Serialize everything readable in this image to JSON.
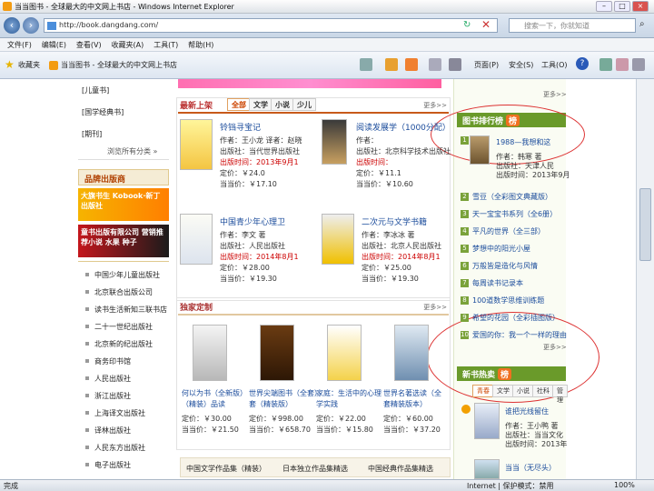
{
  "window": {
    "title": "当当图书 - 全球最大的中文网上书店 - Windows Internet Explorer",
    "min": "–",
    "max": "□",
    "close": "×"
  },
  "address": {
    "url": "http://book.dangdang.com/",
    "search_placeholder": "搜索一下，你就知道"
  },
  "menu": [
    "文件(F)",
    "编辑(E)",
    "查看(V)",
    "收藏夹(A)",
    "工具(T)",
    "帮助(H)"
  ],
  "favbar": {
    "favorites": "收藏夹",
    "tab": "当当图书 - 全球最大的中文网上书店",
    "page": "页面(P)",
    "safety": "安全(S)",
    "tools": "工具(O)"
  },
  "left": {
    "links_top": [
      "[儿童书]",
      "[国学经典书]",
      "[期刊]"
    ],
    "more_categories": "浏览所有分类 »",
    "promo_title": "品牌出版商",
    "banner1": "大旗书生 Kobook·新丁 出版社",
    "banner2": "童书出版有限公司 营销推荐小说 水果 种子",
    "publishers": [
      "中国少年儿童出版社",
      "北京联合出版公司",
      "读书生活新知三联书店",
      "二十一世纪出版社",
      "北京新的纪出版社",
      "商务印书馆",
      "人民出版社",
      "浙江出版社",
      "上海译文出版社",
      "译林出版社",
      "人民东方出版社",
      "电子出版社"
    ]
  },
  "center": {
    "new": {
      "title": "最新上架",
      "tabs": [
        "全部",
        "文学",
        "小说",
        "少儿"
      ],
      "more": "更多>>",
      "books": [
        {
          "title": "铃铛寻宝记",
          "l1": "作者：王小龙  译者：赵晓",
          "l2": "出版社：当代世界出版社",
          "l3": "出版时间：2013年9月1",
          "l4": "定价：￥24.0",
          "l5": "当当价：￥17.10"
        },
        {
          "title": "阅读发展学（1000分配）",
          "l1": "作者：",
          "l2": "出版社：北京科学技术出版社",
          "l3": "出版时间：",
          "l4": "定价：￥11.1",
          "l5": "当当价：￥10.60"
        },
        {
          "title": "中国青少年心理卫",
          "l1": "作者：李文 著",
          "l2": "出版社：人民出版社",
          "l3": "出版时间：2014年8月1",
          "l4": "定价：￥28.00",
          "l5": "当当价：￥19.30"
        },
        {
          "title": "二次元与文学书籍",
          "l1": "作者：李冰冰 著",
          "l2": "出版社：北京人民出版社",
          "l3": "出版时间：2014年8月1",
          "l4": "定价：￥25.00",
          "l5": "当当价：￥19.30"
        }
      ]
    },
    "excl": {
      "title": "独家定制",
      "more": "更多>>",
      "books": [
        {
          "title": "何以为书（全新版）",
          "sub": "（精装）品读",
          "p1": "定价：￥30.00",
          "p2": "当当价：￥21.50"
        },
        {
          "title": "世界尖端图书（全套）",
          "sub": "套（精装版）",
          "p1": "定价：￥998.00",
          "p2": "当当价：￥658.70"
        },
        {
          "title": "家庭：生活中的心理",
          "sub": "学实践",
          "p1": "定价：￥22.00",
          "p2": "当当价：￥15.80"
        },
        {
          "title": "世界名著选读（全",
          "sub": "套精装版本）",
          "p1": "定价：￥60.00",
          "p2": "当当价：￥37.20"
        }
      ]
    },
    "bottom_links": [
      "中国文学作品集（精装）",
      "日本独立作品集精选",
      "中国经典作品集精选"
    ]
  },
  "right": {
    "more1": "更多>>",
    "rank_title": "图书排行榜",
    "badge": "榜",
    "top1": {
      "title": "1988—我想和这",
      "l1": "作者：韩寒 著",
      "l2": "出版社：天津人民",
      "l3": "出版时间：2013年9月"
    },
    "ranks": [
      "雪豆（全彩图文典藏版）",
      "天一宝宝书系列（全6册）",
      "平凡的世界（全三部）",
      "梦想中的阳光小屋",
      "万般皆是造化与风情",
      "每周读书记录本",
      "100道数学思维训练题",
      "希望的花园（全彩插图版）",
      "爱国的你：我一个一样的理由"
    ],
    "more2": "更多>>",
    "new_title": "新书热卖",
    "new_badge": "榜",
    "new_tabs": [
      "青春",
      "文学",
      "小说",
      "社科",
      "管理"
    ],
    "new_book": {
      "title": "谁把光线留住",
      "l1": "作者：王小鸭 著",
      "l2": "出版社：当当文化",
      "l3": "出版时间：2013年"
    },
    "new_book2": "当当（无尽头）"
  },
  "status": {
    "done": "完成",
    "zone": "Internet | 保护模式：禁用",
    "zoom": "100%"
  }
}
